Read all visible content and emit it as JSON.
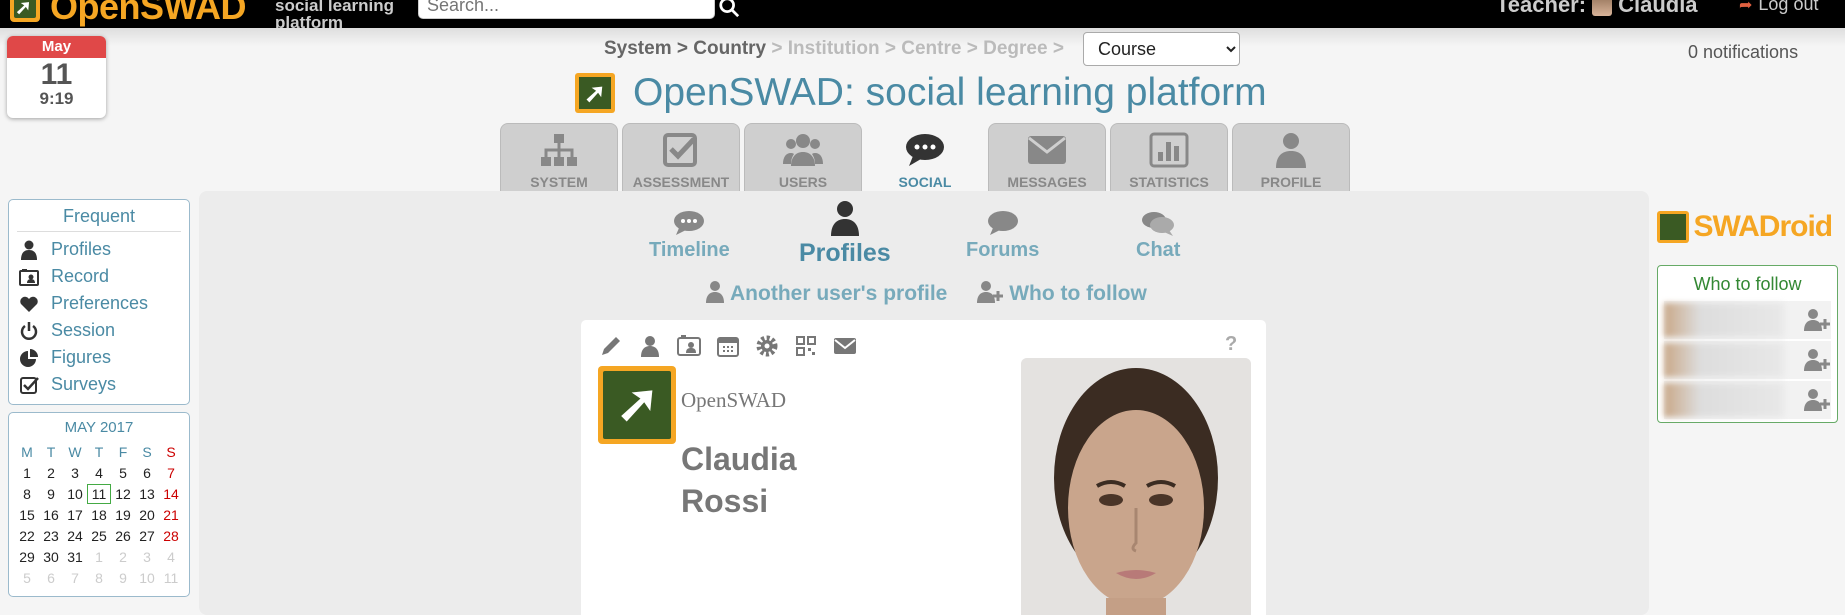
{
  "topbar": {
    "brand": "OpenSWAD",
    "brand_sub": "social learning platform",
    "search_placeholder": "Search...",
    "role_label": "Teacher:",
    "user_short": "Claudia",
    "logout": "Log out"
  },
  "date": {
    "month": "May",
    "day": "11",
    "time": "9:19"
  },
  "breadcrumb": {
    "system": "System",
    "sep": ">",
    "country": "Country",
    "institution": "Institution",
    "centre": "Centre",
    "degree": "Degree",
    "course_select": "Course"
  },
  "notifications": "0 notifications",
  "site_title": "OpenSWAD: social learning platform",
  "tabs": [
    {
      "label": "SYSTEM",
      "icon": "sitemap-icon"
    },
    {
      "label": "ASSESSMENT",
      "icon": "check-square-icon"
    },
    {
      "label": "USERS",
      "icon": "users-icon"
    },
    {
      "label": "SOCIAL",
      "icon": "comments-icon",
      "active": true
    },
    {
      "label": "MESSAGES",
      "icon": "envelope-icon"
    },
    {
      "label": "STATISTICS",
      "icon": "bar-chart-icon"
    },
    {
      "label": "PROFILE",
      "icon": "user-icon"
    }
  ],
  "subtabs": {
    "timeline": "Timeline",
    "profiles": "Profiles",
    "forums": "Forums",
    "chat": "Chat"
  },
  "links": {
    "another_profile": "Another user's profile",
    "who_to_follow": "Who to follow"
  },
  "card": {
    "help": "?",
    "institution": "OpenSWAD",
    "first_name": "Claudia",
    "last_name": "Rossi"
  },
  "frequent": {
    "title": "Frequent",
    "items": [
      "Profiles",
      "Record",
      "Preferences",
      "Session",
      "Figures",
      "Surveys"
    ]
  },
  "calendar": {
    "title": "MAY 2017",
    "headers": [
      "M",
      "T",
      "W",
      "T",
      "F",
      "S",
      "S"
    ],
    "weeks": [
      [
        "1",
        "2",
        "3",
        "4",
        "5",
        "6",
        "7"
      ],
      [
        "8",
        "9",
        "10",
        "11",
        "12",
        "13",
        "14"
      ],
      [
        "15",
        "16",
        "17",
        "18",
        "19",
        "20",
        "21"
      ],
      [
        "22",
        "23",
        "24",
        "25",
        "26",
        "27",
        "28"
      ],
      [
        "29",
        "30",
        "31",
        "1",
        "2",
        "3",
        "4"
      ],
      [
        "5",
        "6",
        "7",
        "8",
        "9",
        "10",
        "11"
      ]
    ],
    "today": "11"
  },
  "swadroid": "SWADroid",
  "follow_box": {
    "title": "Who to follow"
  },
  "colors": {
    "accent": "#4a8aa4",
    "brand": "#f5a623",
    "today_border": "#44aa44",
    "sunday": "#cc0000"
  }
}
